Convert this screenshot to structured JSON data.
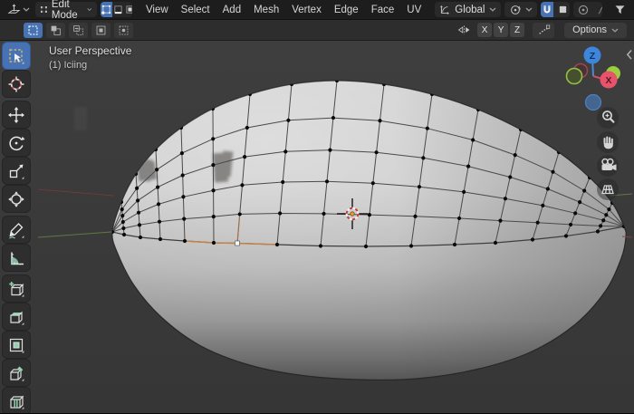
{
  "topbar": {
    "editor_type": "3d-viewport",
    "mode_label": "Edit Mode",
    "select_modes": [
      "vertex",
      "edge",
      "face"
    ],
    "active_select_mode": "vertex",
    "menus": [
      "View",
      "Select",
      "Add",
      "Mesh",
      "Vertex",
      "Edge",
      "Face",
      "UV"
    ],
    "orientation_label": "Global",
    "snap_enabled": true
  },
  "tool_settings": {
    "selection_mode_icons": [
      "new",
      "extend",
      "subtract",
      "invert",
      "intersect"
    ],
    "active_selection_mode": "new",
    "axis_buttons": [
      "X",
      "Y",
      "Z"
    ],
    "options_label": "Options"
  },
  "viewport": {
    "view_label": "User Perspective",
    "object_label": "(1) Iciing",
    "gizmo": {
      "x_label": "X",
      "z_label": "Z"
    }
  },
  "toolbar_tools": [
    "select-box",
    "cursor",
    "move",
    "rotate",
    "scale",
    "transform",
    "annotate",
    "measure",
    "add-cube",
    "extrude-region",
    "inset-faces",
    "bevel",
    "loop-cut"
  ],
  "active_tool": "select-box",
  "colors": {
    "accent_blue": "#4772b3",
    "axis_x_red": "#e8536b",
    "axis_y_green": "#9acd3f",
    "axis_z_blue": "#3d86dc",
    "selected_edge_orange": "#c2824a",
    "tool_icon_mint": "#8fd4ae"
  }
}
